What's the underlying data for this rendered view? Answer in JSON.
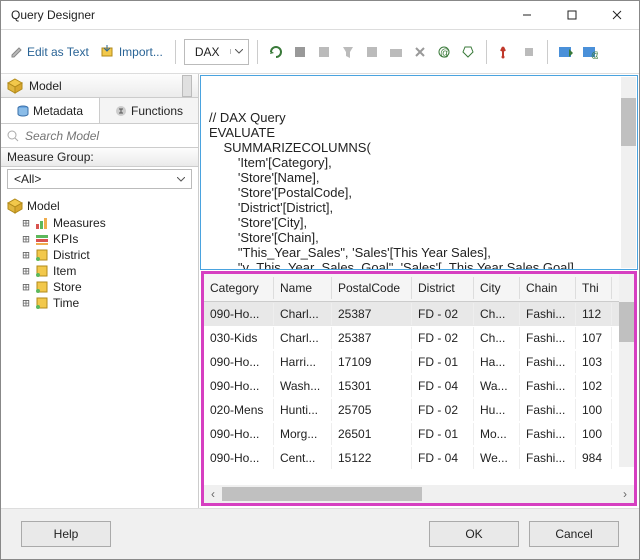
{
  "window": {
    "title": "Query Designer"
  },
  "toolbar": {
    "edit_as_text": "Edit as Text",
    "import_label": "Import...",
    "lang_select": "DAX"
  },
  "left": {
    "header": "Model",
    "tabs": {
      "metadata": "Metadata",
      "functions": "Functions"
    },
    "search_placeholder": "Search Model",
    "measure_group_label": "Measure Group:",
    "measure_group_value": "<All>",
    "tree": {
      "root": "Model",
      "items": [
        {
          "icon": "bars",
          "label": "Measures"
        },
        {
          "icon": "kpi",
          "label": "KPIs"
        },
        {
          "icon": "table",
          "label": "District"
        },
        {
          "icon": "table",
          "label": "Item"
        },
        {
          "icon": "table",
          "label": "Store"
        },
        {
          "icon": "table",
          "label": "Time"
        }
      ]
    }
  },
  "code": {
    "lines": [
      "// DAX Query",
      "EVALUATE",
      "    SUMMARIZECOLUMNS(",
      "        'Item'[Category],",
      "        'Store'[Name],",
      "        'Store'[PostalCode],",
      "        'District'[District],",
      "        'Store'[City],",
      "        'Store'[Chain],",
      "        \"This_Year_Sales\", 'Sales'[This Year Sales],",
      "        \"v_This_Year_Sales_Goal\", 'Sales'[_This Year Sales Goal]"
    ]
  },
  "grid": {
    "headers": [
      "Category",
      "Name",
      "PostalCode",
      "District",
      "City",
      "Chain",
      "Thi"
    ],
    "rows": [
      [
        "090-Ho...",
        "Charl...",
        "25387",
        "FD - 02",
        "Ch...",
        "Fashi...",
        "112"
      ],
      [
        "030-Kids",
        "Charl...",
        "25387",
        "FD - 02",
        "Ch...",
        "Fashi...",
        "107"
      ],
      [
        "090-Ho...",
        "Harri...",
        "17109",
        "FD - 01",
        "Ha...",
        "Fashi...",
        "103"
      ],
      [
        "090-Ho...",
        "Wash...",
        "15301",
        "FD - 04",
        "Wa...",
        "Fashi...",
        "102"
      ],
      [
        "020-Mens",
        "Hunti...",
        "25705",
        "FD - 02",
        "Hu...",
        "Fashi...",
        "100"
      ],
      [
        "090-Ho...",
        "Morg...",
        "26501",
        "FD - 01",
        "Mo...",
        "Fashi...",
        "100"
      ],
      [
        "090-Ho...",
        "Cent...",
        "15122",
        "FD - 04",
        "We...",
        "Fashi...",
        "984"
      ]
    ]
  },
  "buttons": {
    "help": "Help",
    "ok": "OK",
    "cancel": "Cancel"
  },
  "colors": {
    "highlight": "#d63fc1",
    "focus_border": "#4aa3df"
  }
}
